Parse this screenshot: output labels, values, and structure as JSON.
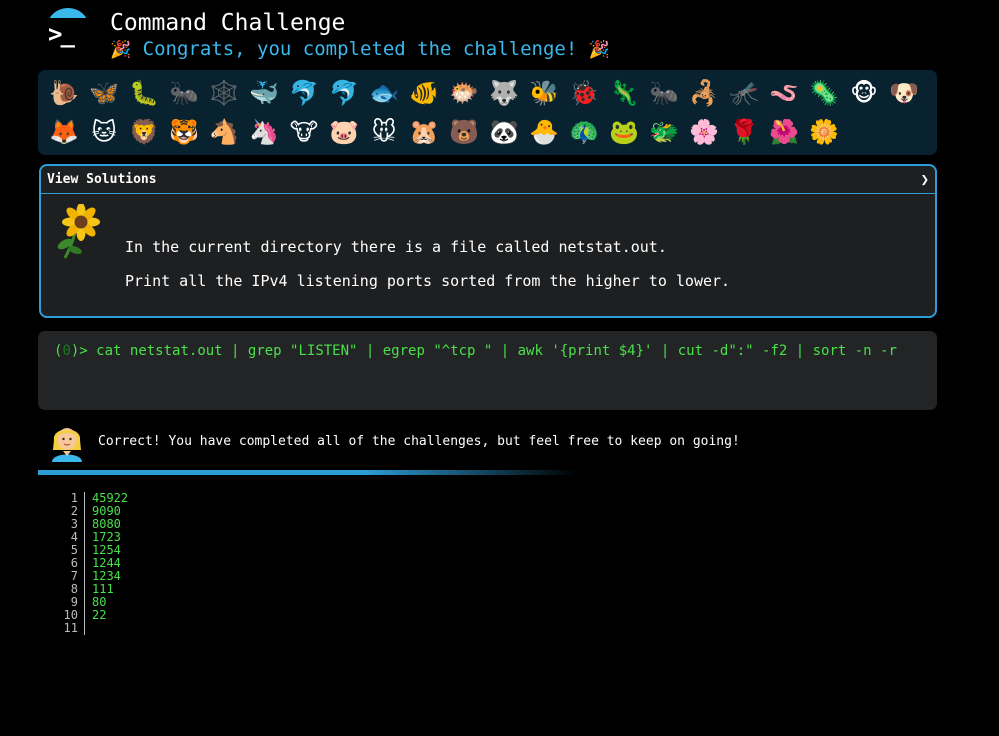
{
  "header": {
    "logo_glyph": ">_",
    "title": "Command Challenge",
    "subtitle_emoji": "🎉",
    "subtitle": "Congrats, you completed the challenge!"
  },
  "emoji_rows": [
    [
      "🐌",
      "🦋",
      "🐛",
      "🐜",
      "🕸️",
      "🐳",
      "🐬",
      "🐬",
      "🐟",
      "🐠",
      "🐡",
      "🐺",
      "🐝",
      "🐞",
      "🦎",
      "🐜",
      "🦂",
      "🦟",
      "🪱",
      "🦠",
      "🐵",
      "🐶"
    ],
    [
      "🦊",
      "🐱",
      "🦁",
      "🐯",
      "🐴",
      "🦄",
      "🐮",
      "🐷",
      "🐭",
      "🐹",
      "🐻",
      "🐼",
      "🐣",
      "🦚",
      "🐸",
      "🐲",
      "🌸",
      "🌹",
      "🌺",
      "🌼"
    ]
  ],
  "solutions": {
    "header": "View Solutions",
    "chevron": "❯",
    "line1": "In the current directory there is a file called netstat.out.",
    "line2": "Print all the IPv4 listening ports sorted from the higher to lower."
  },
  "command": {
    "prefix_open": "(",
    "prefix_zero": "0",
    "prefix_close": ")>",
    "text": "cat netstat.out | grep \"LISTEN\" | egrep \"^tcp \" | awk '{print $4}' | cut -d\":\" -f2 | sort -n -r"
  },
  "feedback": {
    "message": "Correct! You have completed all of the challenges, but feel free to keep on going!"
  },
  "output": {
    "line_numbers": [
      "1",
      "2",
      "3",
      "4",
      "5",
      "6",
      "7",
      "8",
      "9",
      "10",
      "11"
    ],
    "values": [
      "45922",
      "9090",
      "8080",
      "1723",
      "1254",
      "1244",
      "1234",
      "111",
      "80",
      "22",
      ""
    ]
  },
  "colors": {
    "accent": "#3ab8ec",
    "border": "#2d9dd7",
    "output_green": "#4ae04a"
  }
}
